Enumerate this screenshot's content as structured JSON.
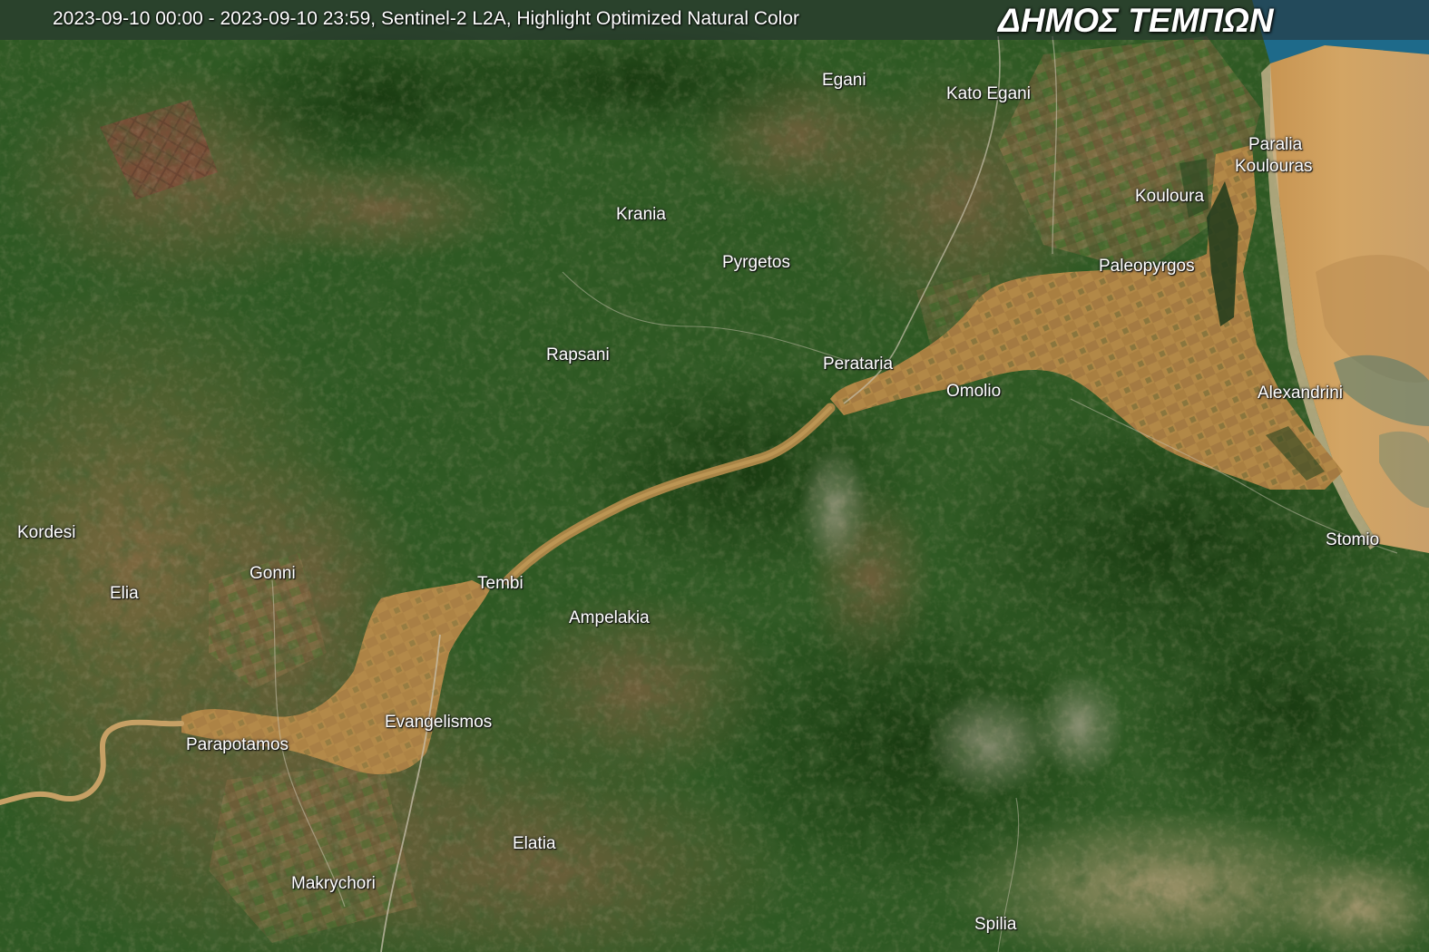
{
  "header": {
    "date_range": "2023-09-10 00:00 - 2023-09-10 23:59, Sentinel-2 L2A, Highlight Optimized Natural Color",
    "title": "ΔΗΜΟΣ ΤΕΜΠΩΝ"
  },
  "colors": {
    "forest": "#2f5a24",
    "forest_dark": "#1f4318",
    "fields": "#8a6b45",
    "flood_water": "#b38a4a",
    "sea": "#1e6b8c",
    "sea_sediment": "#c99a5a"
  },
  "places": {
    "egani": "Egani",
    "kato_egani": "Kato Egani",
    "paralia_koulouras_1": "Paralia",
    "paralia_koulouras_2": "Koulouras",
    "kouloura": "Kouloura",
    "krania": "Krania",
    "pyrgetos": "Pyrgetos",
    "paleopyrgos": "Paleopyrgos",
    "rapsani": "Rapsani",
    "perataria": "Perataria",
    "omolio": "Omolio",
    "alexandrini": "Alexandrini",
    "kordesi": "Kordesi",
    "stomio": "Stomio",
    "gonni": "Gonni",
    "elia": "Elia",
    "tembi": "Tembi",
    "ampelakia": "Ampelakia",
    "evangelismos": "Evangelismos",
    "parapotamos": "Parapotamos",
    "elatia": "Elatia",
    "makrychori": "Makrychori",
    "spilia": "Spilia"
  }
}
